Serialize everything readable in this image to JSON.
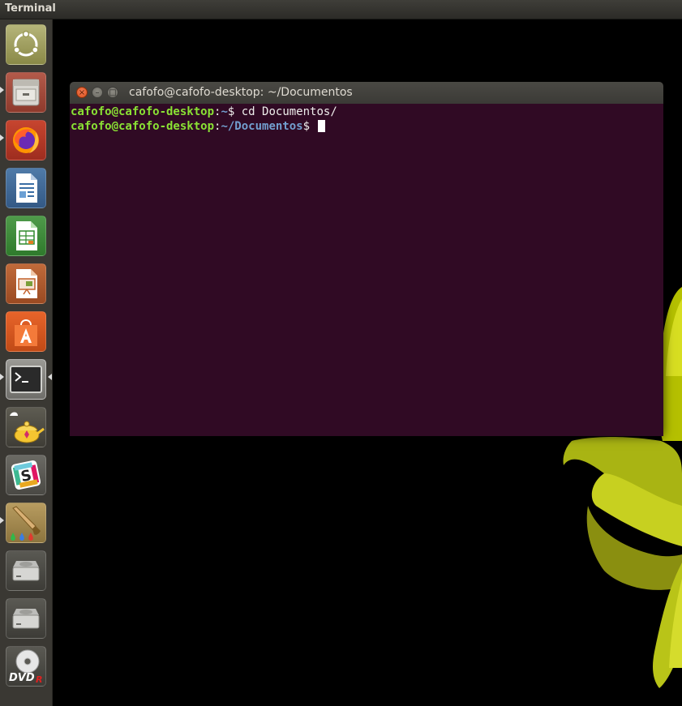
{
  "top_panel": {
    "title": "Terminal"
  },
  "launcher": {
    "items": [
      {
        "name": "dash-home",
        "icon": "ubuntu-logo-icon"
      },
      {
        "name": "files",
        "icon": "file-cabinet-icon",
        "running": true
      },
      {
        "name": "firefox",
        "icon": "firefox-icon",
        "running": true
      },
      {
        "name": "libreoffice-writer",
        "icon": "writer-document-icon"
      },
      {
        "name": "libreoffice-calc",
        "icon": "calc-spreadsheet-icon"
      },
      {
        "name": "libreoffice-impress",
        "icon": "impress-presentation-icon"
      },
      {
        "name": "ubuntu-software",
        "icon": "software-center-bag-icon"
      },
      {
        "name": "terminal",
        "icon": "terminal-icon",
        "running": true,
        "focused": true
      },
      {
        "name": "aladdin-lamp",
        "icon": "lamp-icon"
      },
      {
        "name": "slack",
        "icon": "slack-icon"
      },
      {
        "name": "paint",
        "icon": "paintbrush-icon",
        "running": true
      },
      {
        "name": "drive-1",
        "icon": "hard-drive-icon"
      },
      {
        "name": "drive-2",
        "icon": "hard-drive-icon"
      },
      {
        "name": "dvd",
        "icon": "dvd-r-disc-icon"
      }
    ],
    "dvd_label": "DVD",
    "dvd_sub": "R"
  },
  "window": {
    "title": "cafofo@cafofo-desktop: ~/Documentos",
    "buttons": {
      "close": "×",
      "minimize": "–",
      "maximize": "□"
    }
  },
  "terminal": {
    "line1": {
      "user": "cafofo@cafofo-desktop",
      "sep": ":",
      "path": "~",
      "prompt": "$ ",
      "command": "cd Documentos/"
    },
    "line2": {
      "user": "cafofo@cafofo-desktop",
      "sep": ":",
      "path": "~/Documentos",
      "prompt": "$ "
    }
  },
  "colors": {
    "terminal_bg": "#300a24",
    "prompt_user": "#8ae234",
    "prompt_path": "#729fcf",
    "text": "#eeeeec"
  }
}
